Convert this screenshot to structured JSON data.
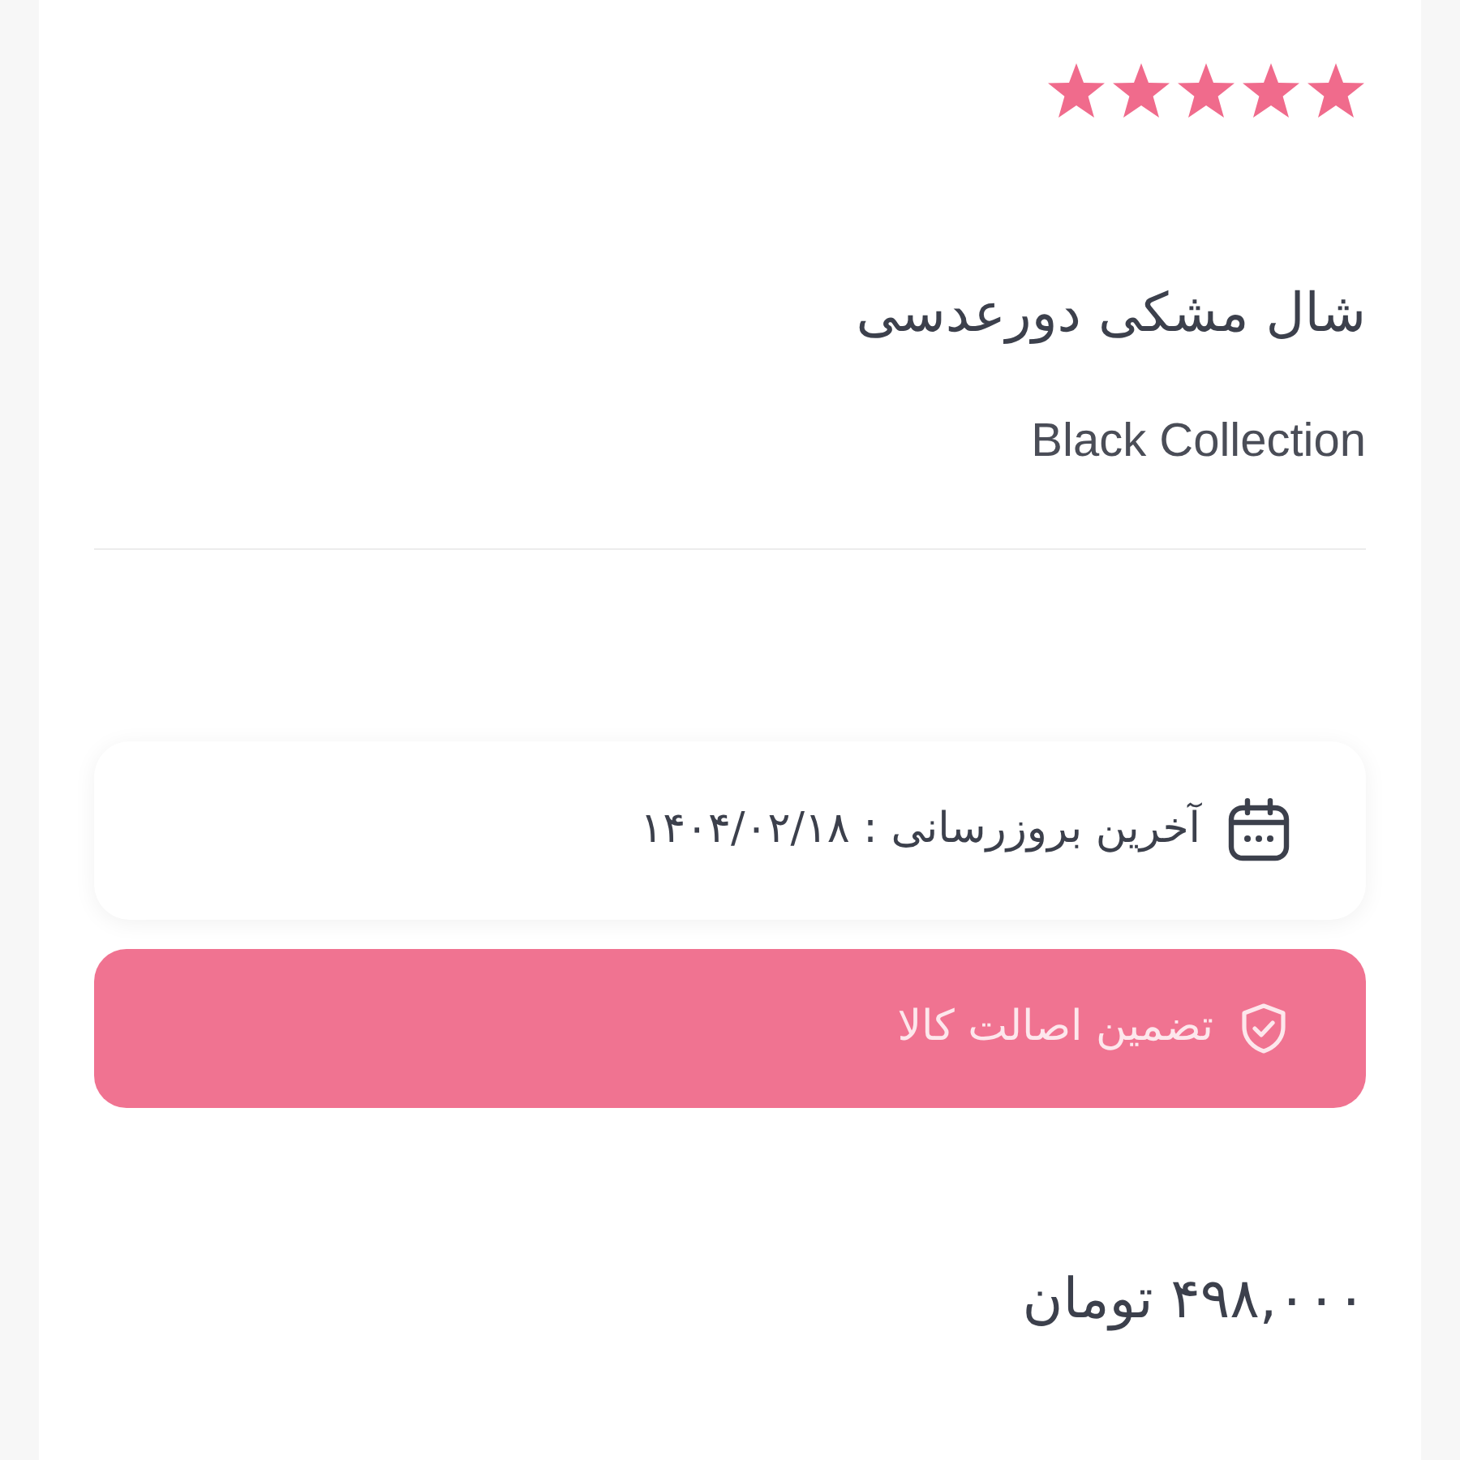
{
  "rating": {
    "stars": 5
  },
  "product": {
    "title": "شال مشکی دورعدسی",
    "collection": "Black Collection"
  },
  "info": {
    "last_update": "آخرین بروزرسانی : ۱۴۰۴/۰۲/۱۸"
  },
  "guarantee": {
    "label": "تضمین اصالت کالا"
  },
  "price": "۴۹۸,۰۰۰ تومان"
}
